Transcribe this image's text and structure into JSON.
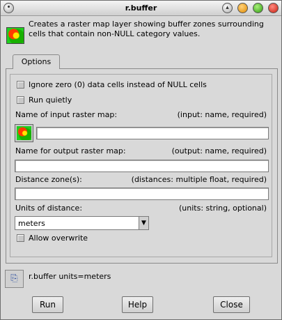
{
  "window": {
    "title": "r.buffer"
  },
  "description": "Creates a raster map layer showing buffer zones surrounding cells that contain non-NULL category values.",
  "tabs": [
    {
      "label": "Options"
    }
  ],
  "options": {
    "ignore_zero": {
      "label": "Ignore zero (0) data cells instead of NULL cells",
      "checked": false
    },
    "run_quietly": {
      "label": "Run quietly",
      "checked": false
    },
    "input": {
      "label": "Name of input raster map:",
      "hint": "(input:  name, required)",
      "value": ""
    },
    "output": {
      "label": "Name for output raster map:",
      "hint": "(output:  name, required)",
      "value": ""
    },
    "distances": {
      "label": "Distance zone(s):",
      "hint": "(distances: multiple float, required)",
      "value": ""
    },
    "units": {
      "label": "Units of distance:",
      "hint": "(units:  string, optional)",
      "selected": "meters"
    },
    "overwrite": {
      "label": "Allow overwrite",
      "checked": false
    }
  },
  "command_line": "r.buffer units=meters",
  "buttons": {
    "run": "Run",
    "help": "Help",
    "close": "Close"
  },
  "icons": {
    "app": "raster-map-icon",
    "input_browse": "raster-map-icon",
    "copy": "copy-icon"
  }
}
